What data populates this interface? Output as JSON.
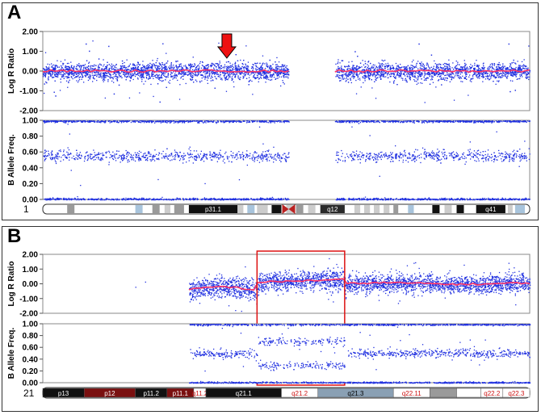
{
  "panels": [
    {
      "letter": "A",
      "chromosome": "1",
      "colors": {
        "points": "#2030e0",
        "trend": "#ff3366",
        "frame": "#5566cc",
        "arrow": "#ee1111"
      },
      "chart_data": [
        {
          "type": "scatter",
          "ylabel": "Log R Ratio",
          "ylim": [
            -2,
            2
          ],
          "y_ticks": [
            "2.00",
            "1.00",
            "0.00",
            "-1.00",
            "-2.00"
          ],
          "x_data_ranges": [
            [
              0.0,
              0.505
            ],
            [
              0.6,
              1.0
            ]
          ],
          "baseline": 0.0,
          "spread": 0.3,
          "annotation": "arrow at 0.378"
        },
        {
          "type": "scatter",
          "ylabel": "B Allele Freq.",
          "ylim": [
            0,
            1
          ],
          "y_ticks": [
            "1.00",
            "0.80",
            "0.60",
            "0.40",
            "0.20",
            "0.00"
          ],
          "bands": [
            0.0,
            0.55,
            1.0
          ],
          "x_data_ranges": [
            [
              0.0,
              0.505
            ],
            [
              0.6,
              1.0
            ]
          ]
        }
      ],
      "ideogram": {
        "bands": [
          {
            "label": "p31.1"
          },
          {
            "label": "q12"
          },
          {
            "label": "q41"
          }
        ]
      }
    },
    {
      "letter": "B",
      "chromosome": "21",
      "colors": {
        "points": "#2030e0",
        "trend": "#ff3366",
        "box": "#dd1111"
      },
      "chart_data": [
        {
          "type": "scatter",
          "ylabel": "Log R Ratio",
          "ylim": [
            -2,
            2
          ],
          "y_ticks": [
            "2.00",
            "1.00",
            "0.00",
            "-1.00",
            "-2.00"
          ],
          "x_data_ranges": [
            [
              0.3,
              1.0
            ]
          ],
          "highlight_region": [
            0.44,
            0.62
          ]
        },
        {
          "type": "scatter",
          "ylabel": "B Allele Freq.",
          "ylim": [
            0,
            1
          ],
          "y_ticks": [
            "1.00",
            "0.80",
            "0.60",
            "0.40",
            "0.20",
            "0.00"
          ],
          "x_data_ranges": [
            [
              0.3,
              1.0
            ]
          ],
          "highlight_region": [
            0.44,
            0.62
          ]
        }
      ],
      "ideogram": {
        "bands": [
          {
            "label": "p13"
          },
          {
            "label": "p12"
          },
          {
            "label": "p11.2"
          },
          {
            "label": "p11.1"
          },
          {
            "label": "q11.2"
          },
          {
            "label": "q21.1"
          },
          {
            "label": "q21.2"
          },
          {
            "label": "q21.3"
          },
          {
            "label": "q22.11"
          },
          {
            "label": "q22.2"
          },
          {
            "label": "q22.3"
          }
        ]
      }
    }
  ]
}
